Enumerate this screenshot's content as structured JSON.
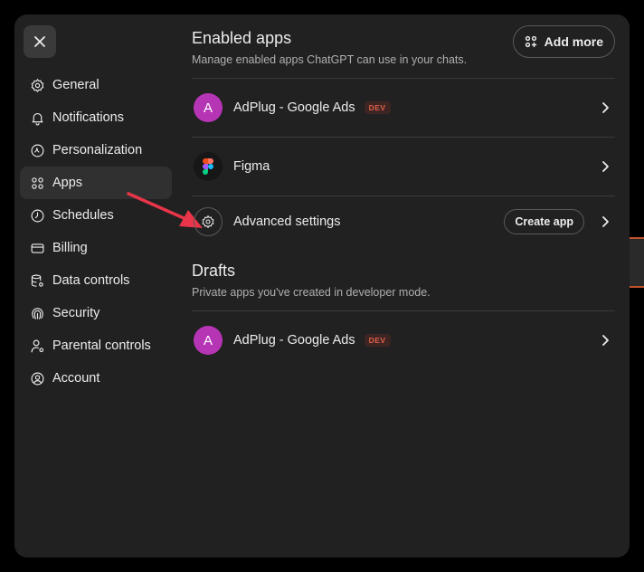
{
  "nav": {
    "items": [
      {
        "label": "General",
        "icon": "gear-icon"
      },
      {
        "label": "Notifications",
        "icon": "bell-icon"
      },
      {
        "label": "Personalization",
        "icon": "sparkle-icon"
      },
      {
        "label": "Apps",
        "icon": "apps-grid-icon",
        "active": true
      },
      {
        "label": "Schedules",
        "icon": "clock-icon"
      },
      {
        "label": "Billing",
        "icon": "card-icon"
      },
      {
        "label": "Data controls",
        "icon": "database-gear-icon"
      },
      {
        "label": "Security",
        "icon": "fingerprint-icon"
      },
      {
        "label": "Parental controls",
        "icon": "person-gear-icon"
      },
      {
        "label": "Account",
        "icon": "user-circle-icon"
      }
    ]
  },
  "enabled": {
    "title": "Enabled apps",
    "subtitle": "Manage enabled apps ChatGPT can use in your chats.",
    "add_more_label": "Add more",
    "apps": [
      {
        "avatar_letter": "A",
        "label": "AdPlug - Google Ads",
        "badge": "DEV"
      },
      {
        "label": "Figma"
      },
      {
        "label": "Advanced settings",
        "action_label": "Create app"
      }
    ]
  },
  "drafts": {
    "title": "Drafts",
    "subtitle": "Private apps you've created in developer mode.",
    "apps": [
      {
        "avatar_letter": "A",
        "label": "AdPlug - Google Ads",
        "badge": "DEV"
      }
    ]
  },
  "colors": {
    "modal_bg": "#212121",
    "active_nav_bg": "#303030",
    "avatar_purple": "#b635b5",
    "badge_red": "#e0604a",
    "annotation_arrow": "#e8354a"
  }
}
